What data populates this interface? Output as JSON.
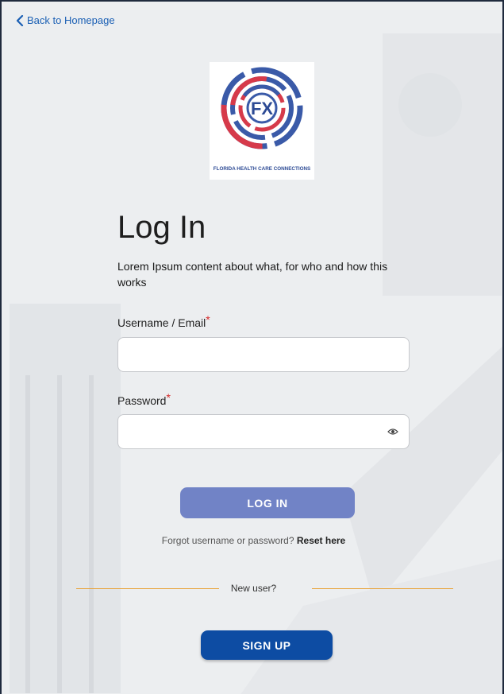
{
  "nav": {
    "back_label": "Back to Homepage"
  },
  "logo": {
    "monogram": "FX",
    "caption": "FLORIDA HEALTH CARE CONNECTIONS"
  },
  "form": {
    "title": "Log In",
    "description": "Lorem Ipsum content about what, for who and how this works",
    "username": {
      "label": "Username / Email",
      "required_mark": "*",
      "value": ""
    },
    "password": {
      "label": "Password",
      "required_mark": "*",
      "value": ""
    },
    "login_button": "LOG IN",
    "forgot_text": "Forgot username or password?",
    "reset_link": "Reset here",
    "new_user_text": "New user?",
    "signup_button": "SIGN UP"
  },
  "colors": {
    "accent_blue": "#1a5fb4",
    "login_button": "#7183c6",
    "signup_button": "#0d4ca3",
    "required": "#d62828",
    "divider": "#e8a33a",
    "logo_blue": "#3a5aa8",
    "logo_red": "#d63a4a"
  },
  "icons": {
    "back": "chevron-left-icon",
    "password_visibility": "eye-icon"
  }
}
